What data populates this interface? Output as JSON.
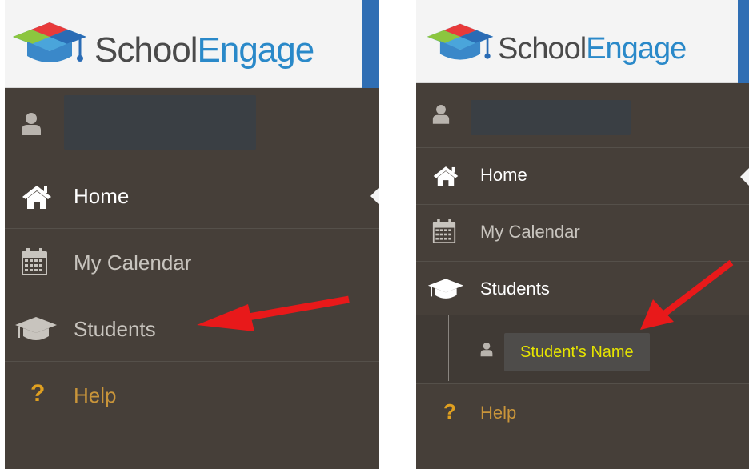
{
  "brand": {
    "name_part1": "School",
    "name_part2": "Engage"
  },
  "colors": {
    "sidebar_bg": "#463f39",
    "header_bg": "#f4f4f4",
    "accent_blue": "#2f6eb4",
    "help_text": "#c9953a",
    "student_name_text": "#e6e400",
    "arrow": "#e8191a"
  },
  "left_panel": {
    "nav": [
      {
        "label": "Home",
        "icon": "home-icon",
        "state": "active"
      },
      {
        "label": "My Calendar",
        "icon": "calendar-icon",
        "state": "default"
      },
      {
        "label": "Students",
        "icon": "graduation-cap-icon",
        "state": "pointed"
      },
      {
        "label": "Help",
        "icon": "question-icon",
        "state": "default"
      }
    ]
  },
  "right_panel": {
    "nav": [
      {
        "label": "Home",
        "icon": "home-icon",
        "state": "active"
      },
      {
        "label": "My Calendar",
        "icon": "calendar-icon",
        "state": "default"
      },
      {
        "label": "Students",
        "icon": "graduation-cap-icon",
        "state": "expanded"
      },
      {
        "label": "Help",
        "icon": "question-icon",
        "state": "default"
      }
    ],
    "students_sub": [
      {
        "label": "Student's Name",
        "icon": "user-icon"
      }
    ]
  }
}
